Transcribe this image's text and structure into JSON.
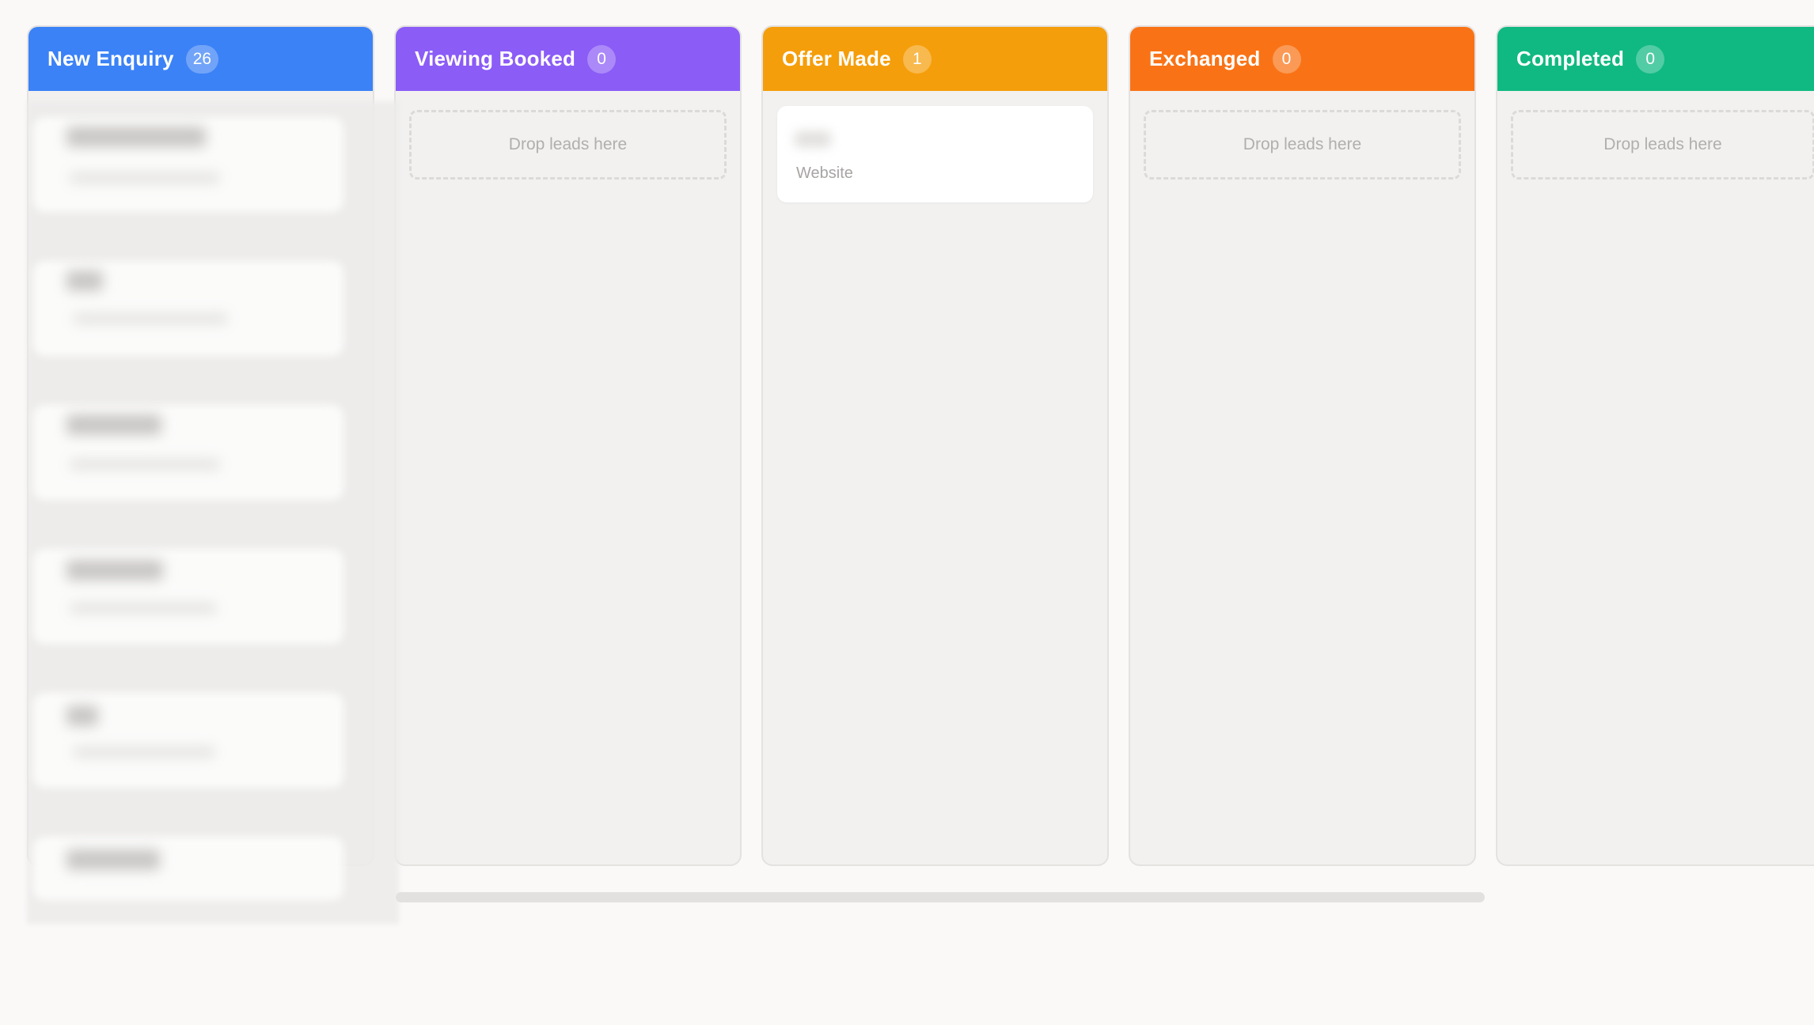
{
  "columns": [
    {
      "title": "New Enquiry",
      "count": "26",
      "color": "#3b82f6"
    },
    {
      "title": "Viewing Booked",
      "count": "0",
      "color": "#8b5cf6",
      "drop_text": "Drop leads here"
    },
    {
      "title": "Offer Made",
      "count": "1",
      "color": "#f59e0b",
      "card": {
        "source": "Website"
      }
    },
    {
      "title": "Exchanged",
      "count": "0",
      "color": "#f97316",
      "drop_text": "Drop leads here"
    },
    {
      "title": "Completed",
      "count": "0",
      "color": "#10b981",
      "drop_text": "Drop leads here"
    }
  ]
}
